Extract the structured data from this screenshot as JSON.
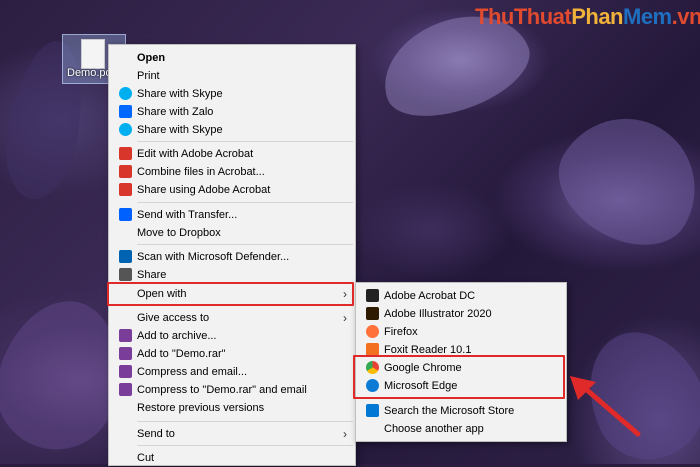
{
  "watermark": {
    "part1": "ThuThuat",
    "part2": "Phan",
    "part3": "Mem",
    "part4": ".vn"
  },
  "desktop_file": {
    "name": "Demo.pd"
  },
  "context_menu": {
    "items": [
      {
        "label": "Open",
        "icon": "none",
        "bold": true
      },
      {
        "label": "Print",
        "icon": "none"
      },
      {
        "label": "Share with Skype",
        "icon": "skype-icon"
      },
      {
        "label": "Share with Zalo",
        "icon": "zalo-icon"
      },
      {
        "label": "Share with Skype",
        "icon": "skype-icon"
      },
      {
        "label": "Edit with Adobe Acrobat",
        "icon": "acrobat-icon"
      },
      {
        "label": "Combine files in Acrobat...",
        "icon": "acrobat-icon"
      },
      {
        "label": "Share using Adobe Acrobat",
        "icon": "acrobat-icon"
      },
      {
        "label": "Send with Transfer...",
        "icon": "dropbox-icon"
      },
      {
        "label": "Move to Dropbox",
        "icon": "none"
      },
      {
        "label": "Scan with Microsoft Defender...",
        "icon": "defender-icon"
      },
      {
        "label": "Share",
        "icon": "share-icon"
      },
      {
        "label": "Open with",
        "icon": "none",
        "submenu": true
      },
      {
        "label": "Give access to",
        "icon": "none",
        "submenu": true
      },
      {
        "label": "Add to archive...",
        "icon": "winrar-icon"
      },
      {
        "label": "Add to \"Demo.rar\"",
        "icon": "winrar-icon"
      },
      {
        "label": "Compress and email...",
        "icon": "winrar-icon"
      },
      {
        "label": "Compress to \"Demo.rar\" and email",
        "icon": "winrar-icon"
      },
      {
        "label": "Restore previous versions",
        "icon": "none"
      },
      {
        "label": "Send to",
        "icon": "none",
        "submenu": true
      },
      {
        "label": "Cut",
        "icon": "none"
      }
    ]
  },
  "open_with_menu": {
    "items": [
      {
        "label": "Adobe Acrobat DC",
        "icon": "acrobat-dc-icon"
      },
      {
        "label": "Adobe Illustrator 2020",
        "icon": "illustrator-icon"
      },
      {
        "label": "Firefox",
        "icon": "firefox-icon"
      },
      {
        "label": "Foxit Reader 10.1",
        "icon": "foxit-icon"
      },
      {
        "label": "Google Chrome",
        "icon": "chrome-icon"
      },
      {
        "label": "Microsoft Edge",
        "icon": "edge-icon"
      },
      {
        "label": "Search the Microsoft Store",
        "icon": "store-icon"
      },
      {
        "label": "Choose another app",
        "icon": "none"
      }
    ]
  },
  "colors": {
    "highlight": "#e02a2a",
    "menu_bg": "#f2f2f2"
  }
}
